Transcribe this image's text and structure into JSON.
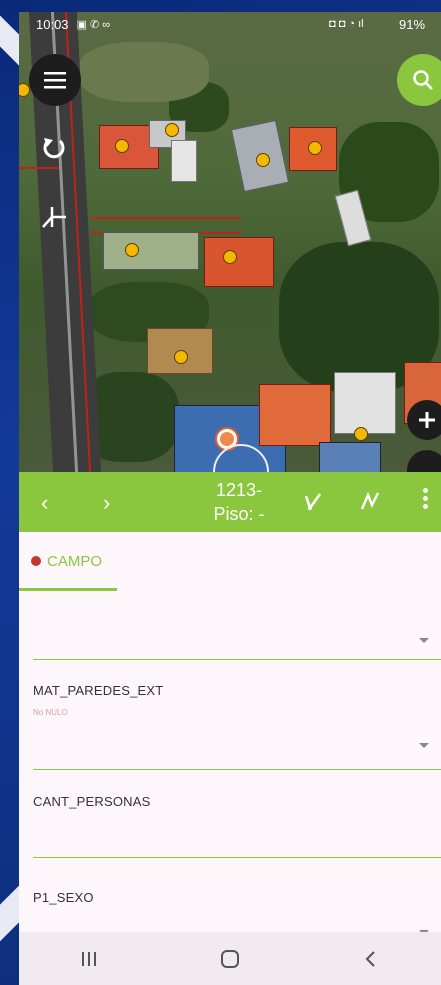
{
  "status_bar": {
    "time": "10:03",
    "battery": "91%"
  },
  "toolbar": {
    "title_line1": "1213-",
    "title_line2": "Piso: -"
  },
  "tabs": [
    {
      "label": "CAMPO"
    }
  ],
  "fields": [
    {
      "label": "",
      "hint": ""
    },
    {
      "label": "MAT_PAREDES_EXT",
      "hint": "No NULO"
    },
    {
      "label": "CANT_PERSONAS",
      "hint": ""
    },
    {
      "label": "P1_SEXO",
      "hint": ""
    }
  ],
  "colors": {
    "accent_green": "#8bc63f",
    "point_yellow": "#f5b800",
    "tab_dot_red": "#c0392b"
  },
  "icons": [
    "menu-icon",
    "search-icon",
    "rotate-icon",
    "node-icon",
    "zoom-in-icon",
    "prev-icon",
    "next-icon",
    "edit-vertex-icon",
    "draw-icon",
    "more-icon",
    "recents-icon",
    "home-icon",
    "back-icon"
  ]
}
